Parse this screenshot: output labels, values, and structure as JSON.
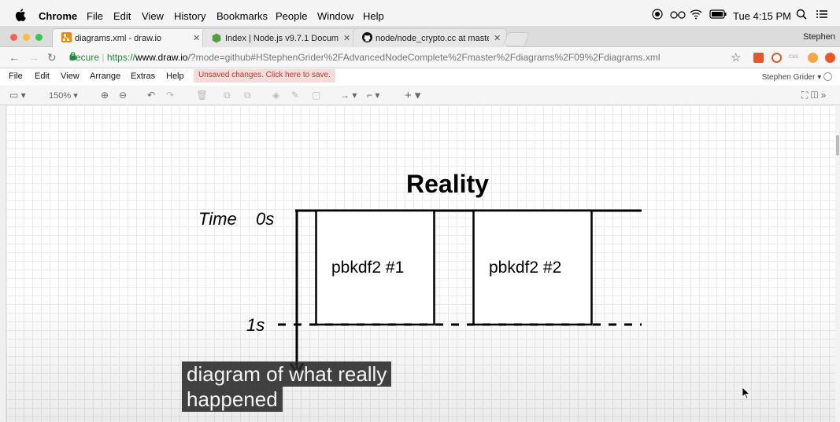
{
  "menubar": {
    "app": "Chrome",
    "items": [
      "File",
      "Edit",
      "View",
      "History",
      "Bookmarks",
      "People",
      "Window",
      "Help"
    ],
    "clock": "Tue 4:15 PM"
  },
  "tabs": [
    {
      "title": "diagrams.xml - draw.io",
      "active": true
    },
    {
      "title": "Index | Node.js v9.7.1 Documen",
      "active": false
    },
    {
      "title": "node/node_crypto.cc at maste",
      "active": false
    }
  ],
  "profile": "Stephen",
  "address": {
    "secure_label": "Secure",
    "scheme": "https://",
    "host": "www.draw.io",
    "path": "/?mode=github#HStephenGrider%2FAdvancedNodeComplete%2Fmaster%2Fdiagrams%2F09%2Fdiagrams.xml"
  },
  "app_menu": {
    "items": [
      "File",
      "Edit",
      "View",
      "Arrange",
      "Extras",
      "Help"
    ],
    "unsaved": "Unsaved changes. Click here to save.",
    "user": "Stephen Grider"
  },
  "toolbar": {
    "zoom": "150%"
  },
  "diagram": {
    "title": "Reality",
    "time_label": "Time",
    "zero_label": "0s",
    "one_label": "1s",
    "box1": "pbkdf2 #1",
    "box2": "pbkdf2 #2"
  },
  "caption": {
    "line1": "diagram of what really",
    "line2": "happened"
  },
  "colors": {
    "accent_green": "#1e8a3c",
    "unsaved_text": "#c0392b",
    "drawio_orange": "#f08705"
  }
}
